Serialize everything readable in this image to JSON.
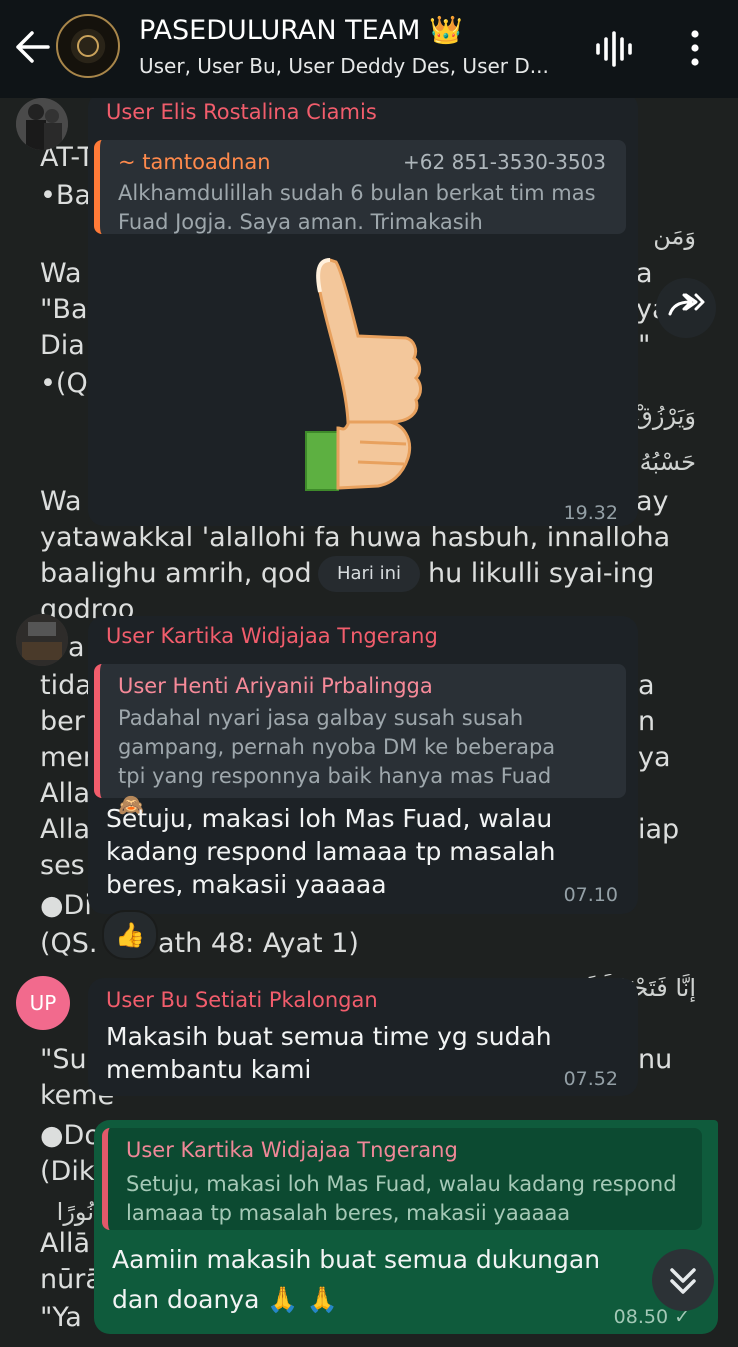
{
  "header": {
    "title": "PASEDULURAN TEAM 👑",
    "subtitle": "User, User Bu, User Deddy Des, User D..."
  },
  "background_post": {
    "lines": [
      "AT-T",
      "•Ba",
      "Wa",
      "\"Ba",
      "Dia",
      "•(QS",
      "Wa",
      "yatawakkal 'alallohi fa huwa hasbuh, innalloha",
      "baalighu amrih, qod",
      "hu likulli syai-ing",
      "qodroo",
      "a",
      "tida",
      "ber",
      "mer",
      "Alla",
      "Alla",
      "ses",
      "●Di",
      "(QS.",
      "ath 48: Ayat 1)",
      "\"Su",
      "keme",
      "●Do",
      "(Dik",
      "Allā",
      "nūrā",
      "\"Ya"
    ],
    "right_fragments": [
      "a",
      "ya",
      "\"",
      "ay",
      "a",
      "n",
      "ya",
      "iap",
      "nu"
    ],
    "arabic": [
      "وَمَن",
      "وَيَرْزُقْ",
      "حَسْبُهُ",
      "إِنَّا فَتَحْنَا لَكَ فَتْحًا مُّبِينًا",
      "نُورًا"
    ]
  },
  "messages": [
    {
      "sender": "User Elis Rostalina Ciamis",
      "quote_name": "~ tamtoadnan",
      "quote_phone": "+62 851-3530-3503",
      "quote_text": "Alkhamdulillah sudah 6 bulan berkat tim mas Fuad Jogja. Saya aman. Trimakasih",
      "sticker": "thumbs-up",
      "time": "19.32"
    },
    {
      "sender": "User Kartika Widjajaa Tngerang",
      "quote_name": "User Henti Ariyanii Prbalingga",
      "quote_text": "Padahal nyari jasa galbay susah susah gampang, pernah nyoba DM ke beberapa tpi yang responnya baik hanya mas Fuad 🙈",
      "text": "Setuju, makasi loh Mas Fuad, walau kadang respond lamaaa tp masalah beres, makasii yaaaaa",
      "time": "07.10",
      "reaction": "👍"
    },
    {
      "sender": "User Bu Setiati Pkalongan",
      "avatar_initials": "UP",
      "text": "Makasih buat semua time yg sudah membantu kami",
      "time": "07.52"
    },
    {
      "quote_name": "User Kartika Widjajaa Tngerang",
      "quote_text": "Setuju, makasi loh Mas Fuad, walau kadang respond lamaaa tp masalah beres, makasii yaaaaa",
      "text": "Aamiin makasih buat semua dukungan dan doanya 🙏 🙏",
      "time": "08.50 ✓"
    }
  ],
  "date_chip": "Hari ini",
  "colors": {
    "header_bg": "#0f1417",
    "incoming_bubble": "#1d2226",
    "outgoing_bubble": "#0f5b3c",
    "sender_name": "#f25d6c",
    "quote_orange": "#ff7a38"
  }
}
